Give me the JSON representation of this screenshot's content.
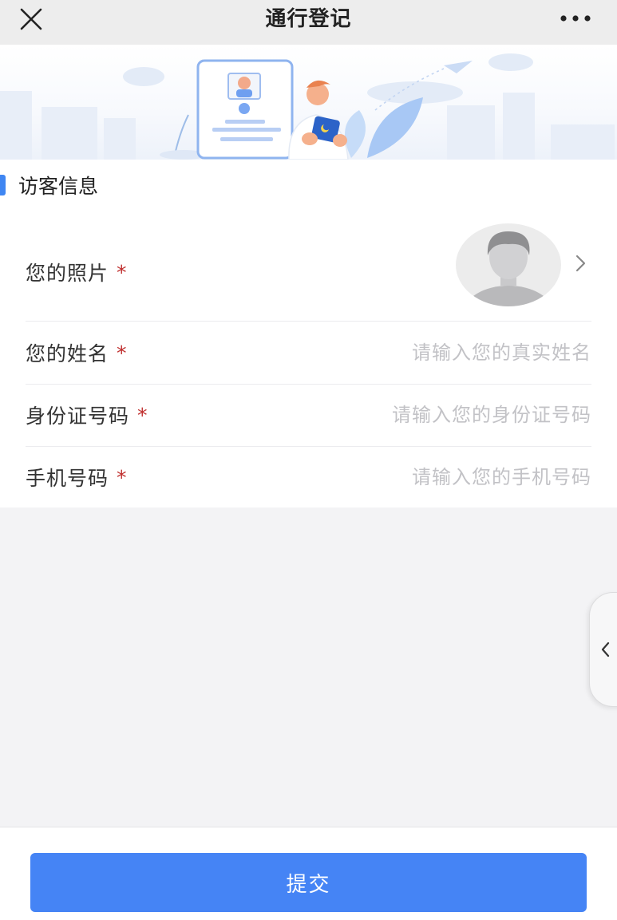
{
  "header": {
    "title": "通行登记",
    "close_icon": "close-icon",
    "more_icon": "more-icon"
  },
  "banner": {
    "illustration": "visitor-registration-illustration"
  },
  "section": {
    "title": "访客信息",
    "accent_color": "#3f86f2"
  },
  "form": {
    "photo": {
      "label": "您的照片",
      "required_mark": "*",
      "icon": "avatar-placeholder-icon"
    },
    "name": {
      "label": "您的姓名",
      "required_mark": "*",
      "placeholder": "请输入您的真实姓名",
      "value": ""
    },
    "id_number": {
      "label": "身份证号码",
      "required_mark": "*",
      "placeholder": "请输入您的身份证号码",
      "value": ""
    },
    "phone": {
      "label": "手机号码",
      "required_mark": "*",
      "placeholder": "请输入您的手机号码",
      "value": ""
    }
  },
  "side_tab": {
    "icon": "chevron-left-icon"
  },
  "footer": {
    "submit_label": "提交",
    "submit_color": "#4584f5"
  }
}
